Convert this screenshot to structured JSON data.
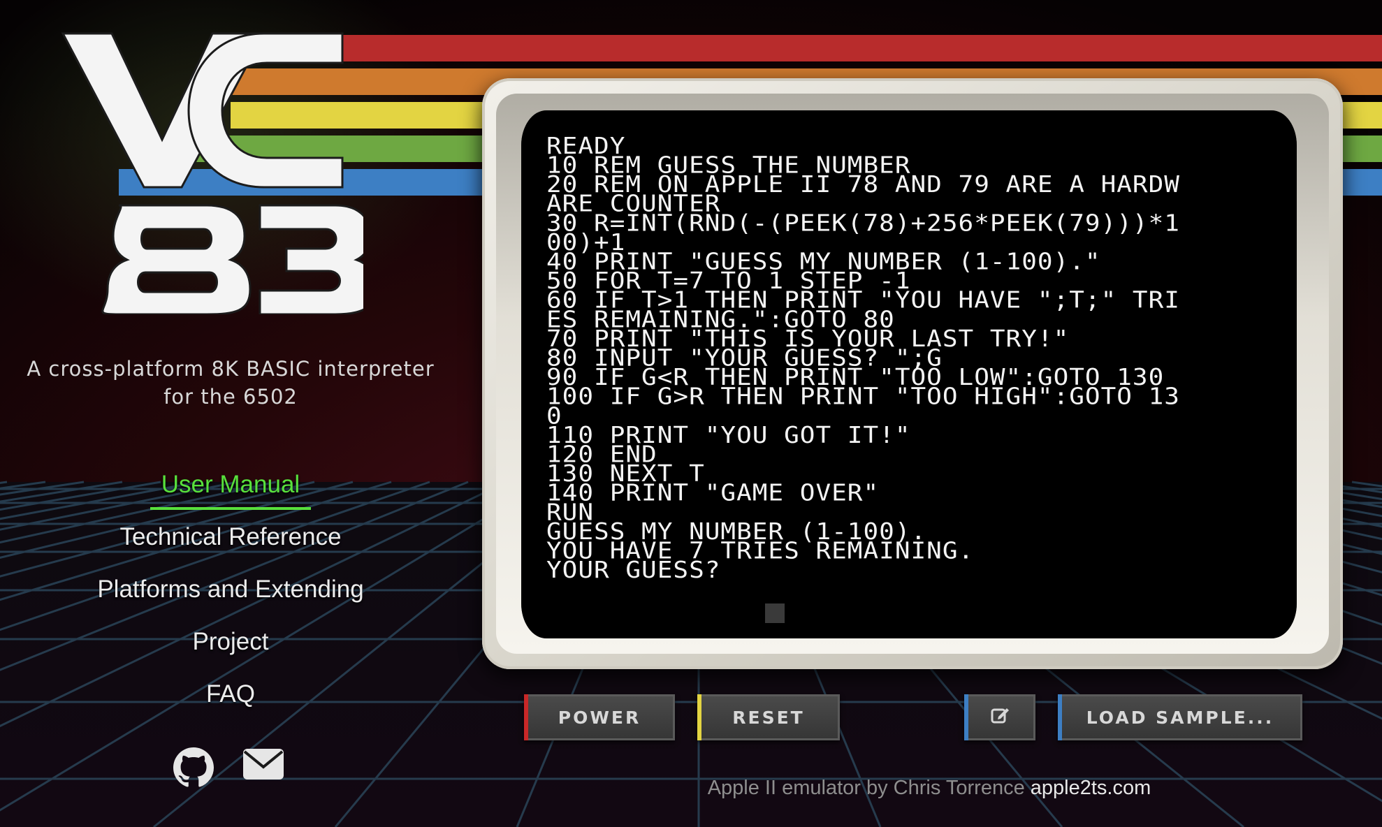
{
  "logo": {
    "top": "VC",
    "bottom": "83"
  },
  "tagline": [
    "A cross-platform 8K BASIC interpreter",
    "for the 6502"
  ],
  "nav": {
    "items": [
      {
        "label": "User Manual",
        "active": true
      },
      {
        "label": "Technical Reference"
      },
      {
        "label": "Platforms and Extending"
      },
      {
        "label": "Project"
      },
      {
        "label": "FAQ"
      }
    ]
  },
  "social": {
    "github_icon": "github-icon",
    "mail_icon": "envelope-icon"
  },
  "terminal": {
    "lines": [
      "READY",
      "10 REM GUESS THE NUMBER",
      "20 REM ON APPLE II 78 AND 79 ARE A HARDW",
      "ARE COUNTER",
      "30 R=INT(RND(-(PEEK(78)+256*PEEK(79)))*1",
      "00)+1",
      "40 PRINT \"GUESS MY NUMBER (1-100).\"",
      "50 FOR T=7 TO 1 STEP -1",
      "60 IF T>1 THEN PRINT \"YOU HAVE \";T;\" TRI",
      "ES REMAINING.\":GOTO 80",
      "70 PRINT \"THIS IS YOUR LAST TRY!\"",
      "80 INPUT \"YOUR GUESS? \";G",
      "90 IF G<R THEN PRINT \"TOO LOW\":GOTO 130",
      "100 IF G>R THEN PRINT \"TOO HIGH\":GOTO 13",
      "0",
      "110 PRINT \"YOU GOT IT!\"",
      "120 END",
      "130 NEXT T",
      "140 PRINT \"GAME OVER\"",
      "RUN",
      "GUESS MY NUMBER (1-100).",
      "YOU HAVE 7 TRIES REMAINING.",
      "YOUR GUESS? "
    ]
  },
  "controls": {
    "power": "POWER",
    "reset": "RESET",
    "edit_icon": "edit-icon",
    "load_sample": "LOAD SAMPLE..."
  },
  "credit": {
    "text": "Apple II emulator by Chris Torrence",
    "link": "apple2ts.com"
  },
  "colors": {
    "stripe_red": "#b82c2c",
    "stripe_orange": "#cf7a2e",
    "stripe_yellow": "#e3d442",
    "stripe_green": "#6ea842",
    "stripe_blue": "#3d7fc4",
    "nav_active": "#58e03c",
    "grid_line": "#1f3345"
  }
}
